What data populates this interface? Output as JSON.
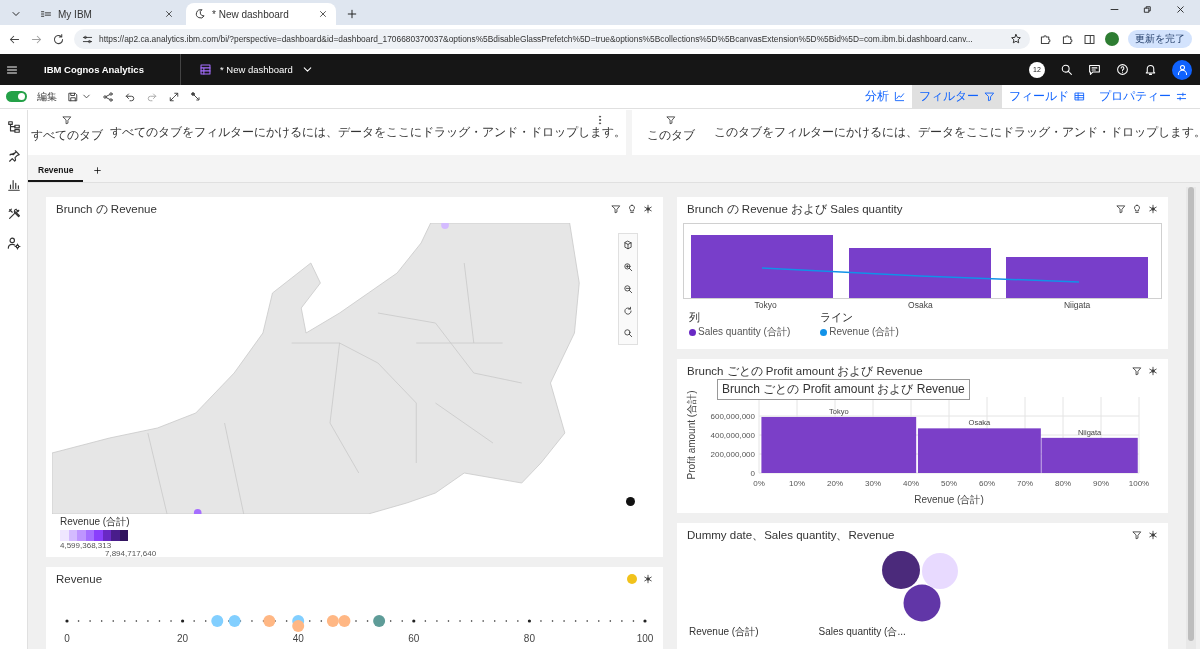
{
  "browser": {
    "tabs": [
      {
        "title": "My IBM",
        "selected": false
      },
      {
        "title": "* New dashboard",
        "selected": true
      }
    ],
    "url": "https://ap2.ca.analytics.ibm.com/bi/?perspective=dashboard&id=dashboard_1706680370037&options%5BdisableGlassPrefetch%5D=true&options%5Bcollections%5D%5BcanvasExtension%5D%5Bid%5D=com.ibm.bi.dashboard.canv...",
    "update_button": "更新を完了"
  },
  "app_header": {
    "product": "IBM Cognos Analytics",
    "dashboard_title": "* New dashboard",
    "notification_count": "12"
  },
  "toolbar": {
    "edit": {
      "label": "編集",
      "on": true
    },
    "panels": [
      {
        "label": "分析",
        "selected": false
      },
      {
        "label": "フィルター",
        "selected": true
      },
      {
        "label": "フィールド",
        "selected": false
      },
      {
        "label": "プロパティー",
        "selected": false
      }
    ]
  },
  "filters": [
    {
      "scope": "すべてのタブ",
      "message": "すべてのタブをフィルターにかけるには、データをここにドラッグ・アンド・ドロップします。"
    },
    {
      "scope": "このタブ",
      "message": "このタブをフィルターにかけるには、データをここにドラッグ・アンド・ドロップします。"
    }
  ],
  "tabs": [
    {
      "label": "Revenue",
      "selected": true
    }
  ],
  "left_column": [
    {
      "kind": "map",
      "title": "Brunch の Revenue",
      "legend": {
        "title": "Revenue (合計)",
        "min": "4,599,368,313",
        "max": "7,894,717,640"
      }
    },
    {
      "kind": "dotplot",
      "title": "Revenue",
      "axis_labels": [
        "0",
        "20",
        "40",
        "60",
        "80",
        "100"
      ]
    }
  ],
  "right_column": [
    {
      "kind": "combo",
      "title": "Brunch の Revenue および Sales quantity",
      "categories": [
        "Tokyo",
        "Osaka",
        "Niigata"
      ],
      "legend": [
        {
          "group": "列",
          "label": "Sales quantity (合計)",
          "color": "#6929c4"
        },
        {
          "group": "ライン",
          "label": "Revenue (合計)",
          "color": "#1192e8"
        }
      ]
    },
    {
      "kind": "marimekko",
      "title": "Brunch ごとの Profit amount および Revenue",
      "tooltip": "Brunch ごとの Profit amount および Revenue",
      "chart_data": {
        "type": "bar",
        "xlabel": "Revenue (合計)",
        "ylabel": "Profit amount (合計)",
        "x": [
          21,
          58,
          87
        ],
        "xlim": [
          0,
          100
        ],
        "grid": true,
        "series": [
          {
            "color": "#7b3fc8",
            "values": [
              590000000,
              470000000,
              370000000
            ]
          }
        ],
        "annotations": [
          {
            "x": 21,
            "y": 590000000,
            "text": "Tokyo"
          },
          {
            "x": 58,
            "y": 470000000,
            "text": "Osaka"
          },
          {
            "x": 87,
            "y": 370000000,
            "text": "Niigata"
          }
        ],
        "ylim": [
          0,
          800000000
        ],
        "yticks": [
          {
            "value": 0,
            "label": "0"
          },
          {
            "value": 200000000,
            "label": "200,000,000"
          },
          {
            "value": 400000000,
            "label": "400,000,000"
          },
          {
            "value": 600000000,
            "label": "600,000,000"
          }
        ],
        "xticks": [
          {
            "value": 0,
            "label": "0%"
          },
          {
            "value": 10,
            "label": "10%"
          },
          {
            "value": 20,
            "label": "20%"
          },
          {
            "value": 30,
            "label": "30%"
          },
          {
            "value": 40,
            "label": "40%"
          },
          {
            "value": 50,
            "label": "50%"
          },
          {
            "value": 60,
            "label": "60%"
          },
          {
            "value": 70,
            "label": "70%"
          },
          {
            "value": 80,
            "label": "80%"
          },
          {
            "value": 90,
            "label": "90%"
          },
          {
            "value": 100,
            "label": "100%"
          }
        ]
      }
    },
    {
      "kind": "bubble",
      "title": "Dummy date、Sales quantity、Revenue",
      "legend": [
        "Revenue (合計)",
        "Sales quantity (合..."
      ]
    }
  ]
}
